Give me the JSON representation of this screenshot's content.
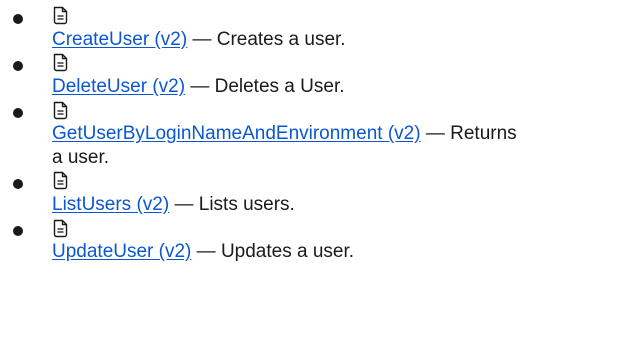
{
  "separator": "—",
  "operations": [
    {
      "name": "CreateUser (v2)",
      "description": "Creates a user.",
      "icon": "document-icon"
    },
    {
      "name": "DeleteUser (v2)",
      "description": "Deletes a User.",
      "icon": "document-icon"
    },
    {
      "name": "GetUserByLoginNameAndEnvironment (v2)",
      "description": "Returns a user.",
      "icon": "document-icon"
    },
    {
      "name": "ListUsers (v2)",
      "description": "Lists users.",
      "icon": "document-icon"
    },
    {
      "name": "UpdateUser (v2)",
      "description": "Updates a user.",
      "icon": "document-icon"
    }
  ],
  "colors": {
    "link": "#0b57d0",
    "text": "#1a1a1a"
  }
}
